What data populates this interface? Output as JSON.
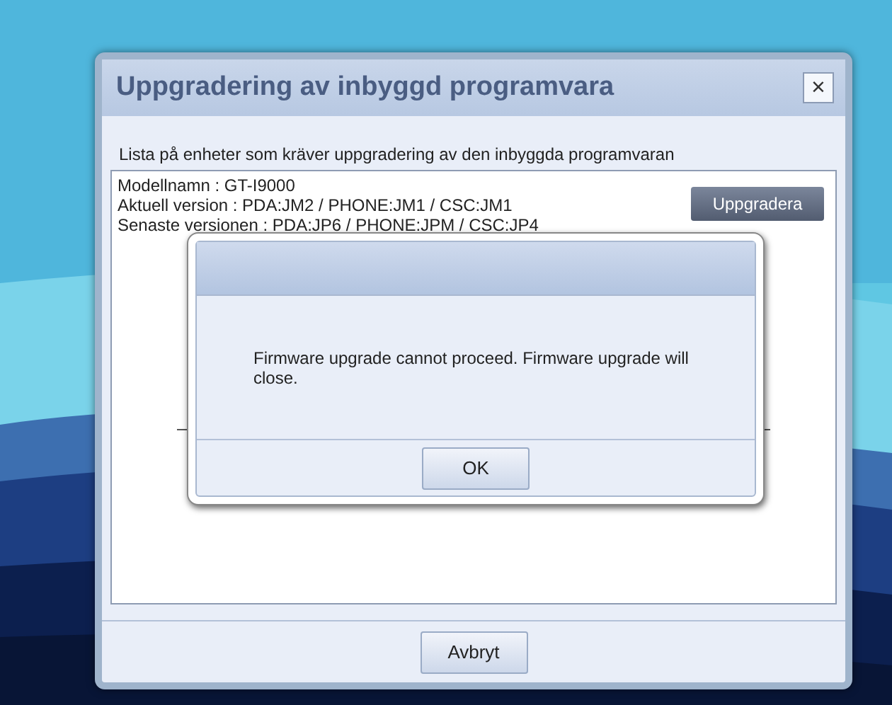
{
  "window": {
    "title": "Uppgradering av inbyggd programvara",
    "close": "×"
  },
  "instruction": "Lista på enheter som kräver uppgradering av den inbyggda programvaran",
  "devices": [
    {
      "lines": [
        "Modellnamn : GT-I9000",
        "Aktuell version : PDA:JM2 / PHONE:JM1 / CSC:JM1",
        "Senaste versionen : PDA:JP6 / PHONE:JPM / CSC:JP4"
      ],
      "button": "Uppgradera"
    }
  ],
  "cancel_button": "Avbryt",
  "message_box": {
    "message": "Firmware upgrade cannot proceed. Firmware upgrade will close.",
    "button": "OK"
  }
}
